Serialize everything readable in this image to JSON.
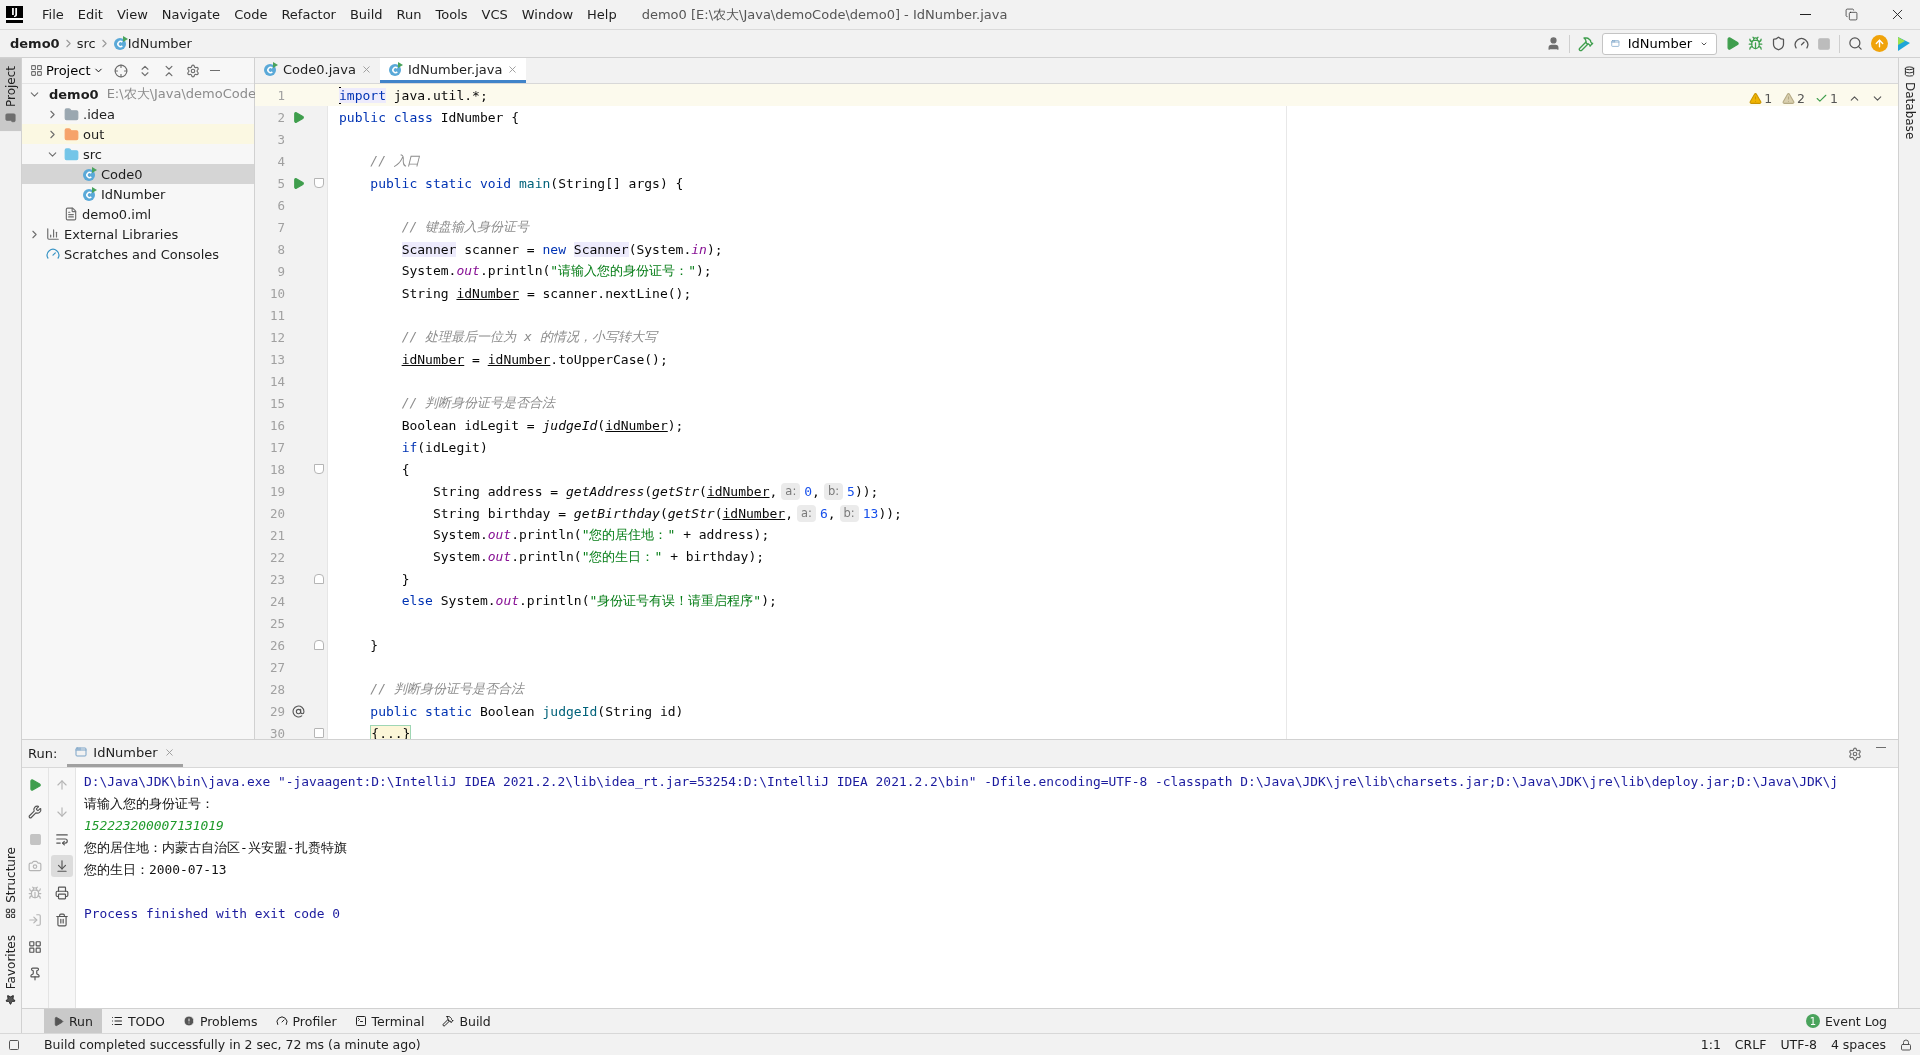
{
  "title_bar": {
    "logo_text": "IJ",
    "menu": [
      "File",
      "Edit",
      "View",
      "Navigate",
      "Code",
      "Refactor",
      "Build",
      "Run",
      "Tools",
      "VCS",
      "Window",
      "Help"
    ],
    "title": "demo0 [E:\\农大\\Java\\demoCode\\demo0] - IdNumber.java"
  },
  "breadcrumb": [
    "demo0",
    "src",
    "IdNumber"
  ],
  "run_config": "IdNumber",
  "side_tabs_left": [
    {
      "label": "Project",
      "selected": true,
      "kind": "project"
    },
    {
      "label": "Structure",
      "selected": false,
      "kind": "structure"
    },
    {
      "label": "Favorites",
      "selected": false,
      "kind": "favorites"
    }
  ],
  "side_tabs_right": [
    {
      "label": "Database",
      "selected": false
    }
  ],
  "project_panel": {
    "title": "Project",
    "tree": [
      {
        "label": "demo0",
        "path": "E:\\农大\\Java\\demoCode",
        "kind": "module",
        "expanded": true,
        "selected": false,
        "children": [
          {
            "label": ".idea",
            "kind": "folder",
            "expanded": false,
            "selected": false
          },
          {
            "label": "out",
            "kind": "excluded-folder",
            "expanded": false,
            "selected": false
          },
          {
            "label": "src",
            "kind": "source-folder",
            "expanded": true,
            "selected": false,
            "children": [
              {
                "label": "Code0",
                "kind": "class",
                "selected": true
              },
              {
                "label": "IdNumber",
                "kind": "class",
                "selected": false
              }
            ]
          },
          {
            "label": "demo0.iml",
            "kind": "file",
            "selected": false
          }
        ]
      },
      {
        "label": "External Libraries",
        "kind": "libraries",
        "expanded": false,
        "selected": false
      },
      {
        "label": "Scratches and Consoles",
        "kind": "scratches",
        "selected": false
      }
    ]
  },
  "editor_tabs": [
    {
      "label": "Code0.java",
      "selected": false
    },
    {
      "label": "IdNumber.java",
      "selected": true
    }
  ],
  "inspections": [
    {
      "kind": "warning",
      "count": "1"
    },
    {
      "kind": "weak-warning",
      "count": "2"
    },
    {
      "kind": "typo",
      "count": "1"
    }
  ],
  "code_lines": [
    {
      "number": "1",
      "kind": "plain",
      "current": true,
      "tokens": [
        {
          "kind": "kw-hl",
          "text": "import"
        },
        {
          "kind": "plain",
          "text": " java.util.*;"
        }
      ]
    },
    {
      "number": "2",
      "kind": "run",
      "current": false,
      "tokens": [
        {
          "kind": "kw",
          "text": "public class"
        },
        {
          "kind": "plain",
          "text": " IdNumber {"
        }
      ]
    },
    {
      "number": "3",
      "kind": "plain",
      "current": false
    },
    {
      "number": "4",
      "kind": "plain",
      "current": false,
      "tokens": [
        {
          "kind": "comment",
          "text": "    // 入口"
        }
      ]
    },
    {
      "number": "5",
      "kind": "run-fold",
      "current": false,
      "tokens": [
        {
          "kind": "kw",
          "text": "    public static void "
        },
        {
          "kind": "decl",
          "text": "main"
        },
        {
          "kind": "plain",
          "text": "(String[] args) {"
        }
      ]
    },
    {
      "number": "6",
      "kind": "plain",
      "current": false
    },
    {
      "number": "7",
      "kind": "plain",
      "current": false,
      "tokens": [
        {
          "kind": "comment",
          "text": "        // 键盘输入身份证号"
        }
      ]
    },
    {
      "number": "8",
      "kind": "plain",
      "current": false,
      "tokens": [
        {
          "kind": "hl",
          "text": "        Scanner"
        },
        {
          "kind": "plain",
          "text": " scanner = "
        },
        {
          "kind": "kw",
          "text": "new "
        },
        {
          "kind": "hl",
          "text": "Scanner"
        },
        {
          "kind": "plain",
          "text": "(System."
        },
        {
          "kind": "field",
          "text": "in"
        },
        {
          "kind": "plain",
          "text": ");"
        }
      ]
    },
    {
      "number": "9",
      "kind": "plain",
      "current": false,
      "tokens": [
        {
          "kind": "plain",
          "text": "        System."
        },
        {
          "kind": "field",
          "text": "out"
        },
        {
          "kind": "plain",
          "text": ".println("
        },
        {
          "kind": "str",
          "text": "\"请输入您的身份证号：\""
        },
        {
          "kind": "plain",
          "text": ");"
        }
      ]
    },
    {
      "number": "10",
      "kind": "plain",
      "current": false,
      "tokens": [
        {
          "kind": "plain",
          "text": "        String "
        },
        {
          "kind": "var",
          "text": "idNumber"
        },
        {
          "kind": "plain",
          "text": " = scanner.nextLine();"
        }
      ]
    },
    {
      "number": "11",
      "kind": "plain",
      "current": false
    },
    {
      "number": "12",
      "kind": "plain",
      "current": false,
      "tokens": [
        {
          "kind": "comment",
          "text": "        // 处理最后一位为 x 的情况，小写转大写"
        }
      ]
    },
    {
      "number": "13",
      "kind": "plain",
      "current": false,
      "tokens": [
        {
          "kind": "var",
          "text": "        idNumber"
        },
        {
          "kind": "plain",
          "text": " = "
        },
        {
          "kind": "var",
          "text": "idNumber"
        },
        {
          "kind": "plain",
          "text": ".toUpperCase();"
        }
      ]
    },
    {
      "number": "14",
      "kind": "plain",
      "current": false
    },
    {
      "number": "15",
      "kind": "plain",
      "current": false,
      "tokens": [
        {
          "kind": "comment",
          "text": "        // 判断身份证号是否合法"
        }
      ]
    },
    {
      "number": "16",
      "kind": "plain",
      "current": false,
      "tokens": [
        {
          "kind": "plain",
          "text": "        Boolean idLegit = "
        },
        {
          "kind": "call",
          "text": "judgeId"
        },
        {
          "kind": "plain",
          "text": "("
        },
        {
          "kind": "var",
          "text": "idNumber"
        },
        {
          "kind": "plain",
          "text": ");"
        }
      ]
    },
    {
      "number": "17",
      "kind": "plain",
      "current": false,
      "tokens": [
        {
          "kind": "kw",
          "text": "        if"
        },
        {
          "kind": "plain",
          "text": "(idLegit)"
        }
      ]
    },
    {
      "number": "18",
      "kind": "fold-start",
      "current": false,
      "tokens": [
        {
          "kind": "plain",
          "text": "        {"
        }
      ]
    },
    {
      "number": "19",
      "kind": "plain",
      "current": false,
      "tokens": [
        {
          "kind": "plain",
          "text": "            String address = "
        },
        {
          "kind": "call",
          "text": "getAddress"
        },
        {
          "kind": "plain",
          "text": "("
        },
        {
          "kind": "call",
          "text": "getStr"
        },
        {
          "kind": "plain",
          "text": "("
        },
        {
          "kind": "var",
          "text": "idNumber"
        },
        {
          "kind": "plain",
          "text": ","
        },
        {
          "kind": "hint",
          "text": "a:"
        },
        {
          "kind": "num",
          "text": "0"
        },
        {
          "kind": "plain",
          "text": ","
        },
        {
          "kind": "hint",
          "text": "b:"
        },
        {
          "kind": "num",
          "text": "5"
        },
        {
          "kind": "plain",
          "text": "));"
        }
      ]
    },
    {
      "number": "20",
      "kind": "plain",
      "current": false,
      "tokens": [
        {
          "kind": "plain",
          "text": "            String birthday = "
        },
        {
          "kind": "call",
          "text": "getBirthday"
        },
        {
          "kind": "plain",
          "text": "("
        },
        {
          "kind": "call",
          "text": "getStr"
        },
        {
          "kind": "plain",
          "text": "("
        },
        {
          "kind": "var",
          "text": "idNumber"
        },
        {
          "kind": "plain",
          "text": ","
        },
        {
          "kind": "hint",
          "text": "a:"
        },
        {
          "kind": "num",
          "text": "6"
        },
        {
          "kind": "plain",
          "text": ","
        },
        {
          "kind": "hint",
          "text": "b:"
        },
        {
          "kind": "num",
          "text": "13"
        },
        {
          "kind": "plain",
          "text": "));"
        }
      ]
    },
    {
      "number": "21",
      "kind": "plain",
      "current": false,
      "tokens": [
        {
          "kind": "plain",
          "text": "            System."
        },
        {
          "kind": "field",
          "text": "out"
        },
        {
          "kind": "plain",
          "text": ".println("
        },
        {
          "kind": "str",
          "text": "\"您的居住地：\""
        },
        {
          "kind": "plain",
          "text": " + address);"
        }
      ]
    },
    {
      "number": "22",
      "kind": "plain",
      "current": false,
      "tokens": [
        {
          "kind": "plain",
          "text": "            System."
        },
        {
          "kind": "field",
          "text": "out"
        },
        {
          "kind": "plain",
          "text": ".println("
        },
        {
          "kind": "str",
          "text": "\"您的生日：\""
        },
        {
          "kind": "plain",
          "text": " + birthday);"
        }
      ]
    },
    {
      "number": "23",
      "kind": "fold-end",
      "current": false,
      "tokens": [
        {
          "kind": "plain",
          "text": "        }"
        }
      ]
    },
    {
      "number": "24",
      "kind": "plain",
      "current": false,
      "tokens": [
        {
          "kind": "kw",
          "text": "        else "
        },
        {
          "kind": "plain",
          "text": "System."
        },
        {
          "kind": "field",
          "text": "out"
        },
        {
          "kind": "plain",
          "text": ".println("
        },
        {
          "kind": "str",
          "text": "\"身份证号有误！请重启程序\""
        },
        {
          "kind": "plain",
          "text": ");"
        }
      ]
    },
    {
      "number": "25",
      "kind": "plain",
      "current": false
    },
    {
      "number": "26",
      "kind": "fold-end",
      "current": false,
      "tokens": [
        {
          "kind": "plain",
          "text": "    }"
        }
      ]
    },
    {
      "number": "27",
      "kind": "plain",
      "current": false
    },
    {
      "number": "28",
      "kind": "plain",
      "current": false,
      "tokens": [
        {
          "kind": "comment",
          "text": "    // 判断身份证号是否合法"
        }
      ]
    },
    {
      "number": "29",
      "kind": "override",
      "current": false,
      "tokens": [
        {
          "kind": "kw",
          "text": "    public static "
        },
        {
          "kind": "plain",
          "text": "Boolean "
        },
        {
          "kind": "decl",
          "text": "judgeId"
        },
        {
          "kind": "plain",
          "text": "(String id)"
        }
      ]
    },
    {
      "number": "30",
      "kind": "collapsed",
      "current": false,
      "tokens": [
        {
          "kind": "folded",
          "text": "    {...}"
        }
      ]
    }
  ],
  "run_panel": {
    "label": "Run:",
    "tab": "IdNumber",
    "output": [
      {
        "kind": "command",
        "text": "D:\\Java\\JDK\\bin\\java.exe \"-javaagent:D:\\IntelliJ IDEA 2021.2.2\\lib\\idea_rt.jar=53254:D:\\IntelliJ IDEA 2021.2.2\\bin\" -Dfile.encoding=UTF-8 -classpath D:\\Java\\JDK\\jre\\lib\\charsets.jar;D:\\Java\\JDK\\jre\\lib\\deploy.jar;D:\\Java\\JDK\\j"
      },
      {
        "kind": "stdout",
        "text": "请输入您的身份证号："
      },
      {
        "kind": "input",
        "text": "152223200007131019"
      },
      {
        "kind": "stdout",
        "text": "您的居住地：内蒙古自治区-兴安盟-扎赉特旗"
      },
      {
        "kind": "stdout",
        "text": "您的生日：2000-07-13"
      },
      {
        "kind": "blank"
      },
      {
        "kind": "exit",
        "text": "Process finished with exit code 0"
      }
    ]
  },
  "tool_windows": [
    {
      "label": "Run",
      "kind": "run",
      "selected": true
    },
    {
      "label": "TODO",
      "kind": "todo",
      "selected": false
    },
    {
      "label": "Problems",
      "kind": "problems",
      "selected": false
    },
    {
      "label": "Profiler",
      "kind": "profiler",
      "selected": false
    },
    {
      "label": "Terminal",
      "kind": "terminal",
      "selected": false
    },
    {
      "label": "Build",
      "kind": "build",
      "selected": false
    }
  ],
  "event_log": {
    "label": "Event Log",
    "badge": "1"
  },
  "status_bar": {
    "message": "Build completed successfully in 2 sec, 72 ms (a minute ago)",
    "items": [
      "1:1",
      "CRLF",
      "UTF-8",
      "4 spaces"
    ]
  }
}
